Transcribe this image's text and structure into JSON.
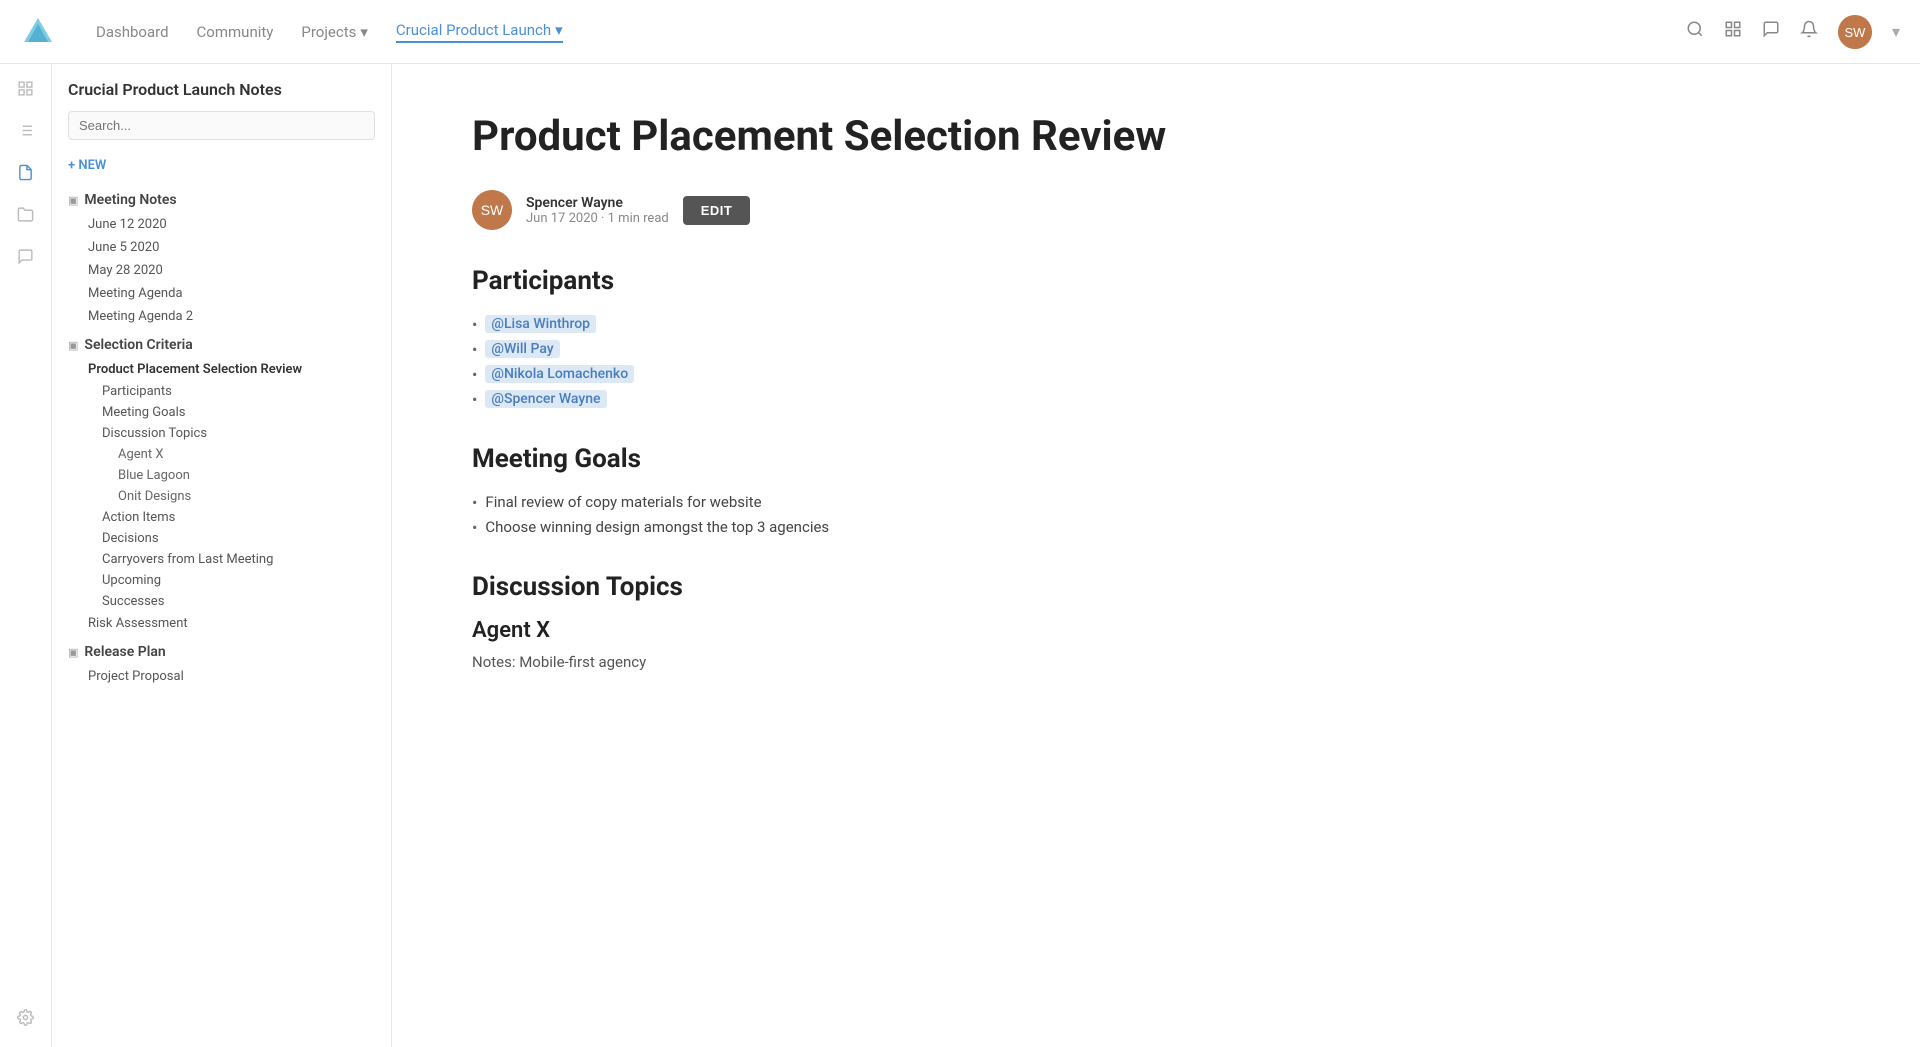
{
  "nav": {
    "logo_alt": "App Logo",
    "links": [
      {
        "id": "dashboard",
        "label": "Dashboard",
        "active": false
      },
      {
        "id": "community",
        "label": "Community",
        "active": false
      },
      {
        "id": "projects",
        "label": "Projects",
        "dropdown": true,
        "active": false
      },
      {
        "id": "crucial-product-launch",
        "label": "Crucial Product Launch",
        "dropdown": true,
        "active": true
      }
    ],
    "icons": [
      "search",
      "grid",
      "chat",
      "bell"
    ],
    "avatar_initials": "SW"
  },
  "icon_bar": {
    "items": [
      {
        "id": "grid-icon",
        "icon": "⊞",
        "active": false
      },
      {
        "id": "list-icon",
        "icon": "☰",
        "active": false
      },
      {
        "id": "doc-icon",
        "icon": "📄",
        "active": true
      },
      {
        "id": "folder-icon",
        "icon": "📁",
        "active": false
      },
      {
        "id": "comment-icon",
        "icon": "💬",
        "active": false
      },
      {
        "id": "settings-icon",
        "icon": "⚙",
        "active": false
      }
    ]
  },
  "sidebar": {
    "title": "Crucial Product Launch Notes",
    "search_placeholder": "Search...",
    "new_label": "+ NEW",
    "groups": [
      {
        "id": "meeting-notes",
        "title": "Meeting Notes",
        "expanded": true,
        "items": [
          {
            "id": "june-12-2020",
            "label": "June 12 2020",
            "active": false
          },
          {
            "id": "june-5-2020",
            "label": "June 5 2020",
            "active": false
          },
          {
            "id": "may-28-2020",
            "label": "May 28 2020",
            "active": false
          },
          {
            "id": "meeting-agenda",
            "label": "Meeting Agenda",
            "active": false
          },
          {
            "id": "meeting-agenda-2",
            "label": "Meeting Agenda 2",
            "active": false
          }
        ]
      },
      {
        "id": "selection-criteria",
        "title": "Selection Criteria",
        "expanded": true,
        "items": [
          {
            "id": "product-placement-selection-review",
            "label": "Product Placement Selection Review",
            "active": true,
            "children": [
              {
                "id": "participants",
                "label": "Participants",
                "active": false
              },
              {
                "id": "meeting-goals",
                "label": "Meeting Goals",
                "active": false
              },
              {
                "id": "discussion-topics",
                "label": "Discussion Topics",
                "active": false,
                "children": [
                  {
                    "id": "agent-x",
                    "label": "Agent X"
                  },
                  {
                    "id": "blue-lagoon",
                    "label": "Blue Lagoon"
                  },
                  {
                    "id": "onit-designs",
                    "label": "Onit Designs"
                  }
                ]
              },
              {
                "id": "action-items",
                "label": "Action Items",
                "active": false
              },
              {
                "id": "decisions",
                "label": "Decisions",
                "active": false
              },
              {
                "id": "carryovers-from-last-meeting",
                "label": "Carryovers from Last Meeting",
                "active": false
              },
              {
                "id": "upcoming",
                "label": "Upcoming",
                "active": false
              },
              {
                "id": "successes",
                "label": "Successes",
                "active": false
              }
            ]
          },
          {
            "id": "risk-assessment",
            "label": "Risk Assessment",
            "active": false
          }
        ]
      },
      {
        "id": "release-plan",
        "title": "Release Plan",
        "expanded": true,
        "items": [
          {
            "id": "project-proposal",
            "label": "Project Proposal",
            "active": false
          }
        ]
      }
    ]
  },
  "document": {
    "title": "Product Placement Selection Review",
    "author_name": "Spencer Wayne",
    "author_date": "Jun 17 2020 · 1 min read",
    "edit_label": "EDIT",
    "sections": [
      {
        "id": "participants",
        "heading": "Participants",
        "type": "mentions",
        "items": [
          "@Lisa Winthrop",
          "@Will Pay",
          "@Nikola Lomachenko",
          "@Spencer Wayne"
        ]
      },
      {
        "id": "meeting-goals",
        "heading": "Meeting Goals",
        "type": "bullets",
        "items": [
          "Final review of copy materials for website",
          "Choose winning design amongst the top 3 agencies"
        ]
      },
      {
        "id": "discussion-topics",
        "heading": "Discussion Topics",
        "type": "sub",
        "subheading": "Agent X",
        "notes": "Notes: Mobile-first agency"
      }
    ]
  }
}
